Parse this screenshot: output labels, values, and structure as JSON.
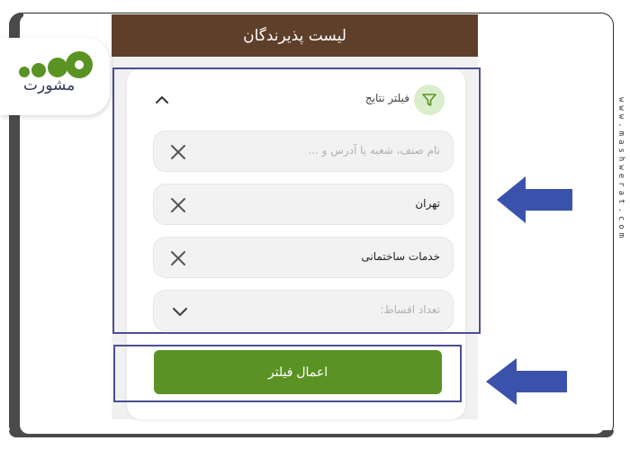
{
  "screen": {
    "title": "لیست پذیرندگان",
    "filter_section": {
      "title": "فیلتر نتایج",
      "icon": "funnel-icon",
      "collapse_icon": "chevron-up-icon"
    },
    "fields": [
      {
        "name": "search",
        "value": "",
        "placeholder": "نام صنف، شعبه یا آدرس و ...",
        "action_icon": "close-icon"
      },
      {
        "name": "city",
        "value": "تهران",
        "placeholder": "",
        "action_icon": "close-icon"
      },
      {
        "name": "category",
        "value": "خدمات ساختمانی",
        "placeholder": "",
        "action_icon": "close-icon"
      },
      {
        "name": "installments",
        "value": "",
        "placeholder": "تعداد اقساط:",
        "action_icon": "chevron-down-icon"
      }
    ],
    "apply_button": "اعمال فیلتر"
  },
  "overlay": {
    "logo_text": "مشورت",
    "site_url": "www.mashwerat.com",
    "highlight_color": "#4b4e96",
    "arrow_color": "#3b52ad"
  },
  "colors": {
    "header": "#5e3f2a",
    "apply_button": "#5a9324",
    "filter_icon_bg": "#dbeecb",
    "logo_green": "#5a9324"
  }
}
